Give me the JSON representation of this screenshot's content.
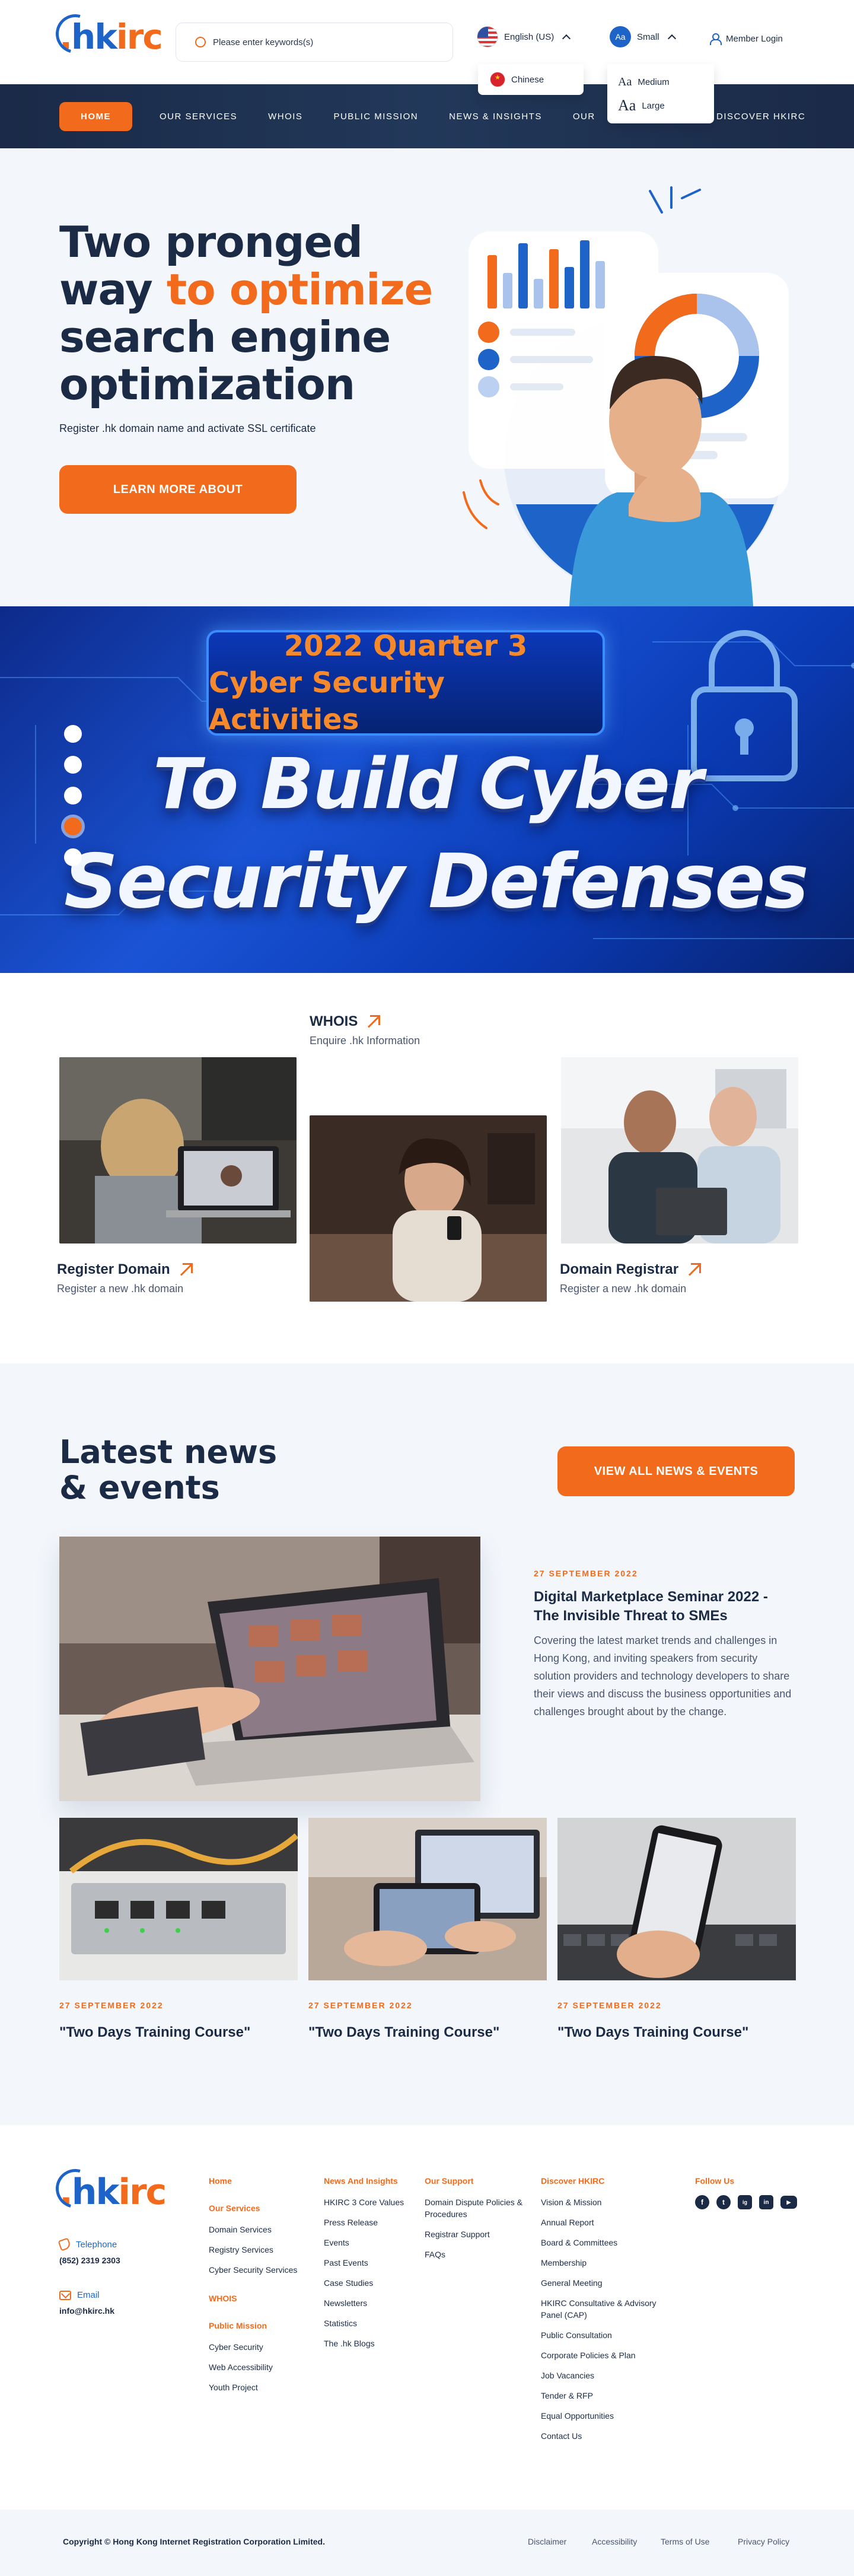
{
  "brand": {
    "dot": ".",
    "hk": "hk",
    "irc": "irc"
  },
  "search": {
    "placeholder": "Please enter keywords(s)"
  },
  "language": {
    "current": "English (US)",
    "option": "Chinese"
  },
  "font_size": {
    "badge": "Aa",
    "current": "Small",
    "options": [
      {
        "glyph": "Aa",
        "label": "Medium"
      },
      {
        "glyph": "Aa",
        "label": "Large"
      }
    ]
  },
  "member_login": "Member Login",
  "nav": {
    "items": [
      "Home",
      "Our Services",
      "WHOIS",
      "Public Mission",
      "News & Insights",
      "Our",
      "Discover HKIRC"
    ]
  },
  "hero": {
    "title_line1": "Two pronged",
    "title_line2a": "way ",
    "title_line2b": "to optimize",
    "title_line3": "search engine",
    "title_line4": "optimization",
    "subtitle": "Register .hk domain name and activate SSL certificate",
    "cta": "LEARN MORE ABOUT"
  },
  "banner": {
    "quarter_line1": "2022 Quarter 3",
    "quarter_line2": "Cyber Security Activities",
    "headline1": "To Build Cyber",
    "headline2": "Security Defenses",
    "slides": 5,
    "active_slide": 4
  },
  "services": [
    {
      "title": "Register Domain",
      "desc": "Register a new .hk domain"
    },
    {
      "title": "WHOIS",
      "desc": "Enquire .hk Information"
    },
    {
      "title": "Domain Registrar",
      "desc": "Register a new .hk domain"
    }
  ],
  "news": {
    "heading_line1": "Latest news",
    "heading_line2": "& events",
    "view_all": "VIEW ALL NEWS & EVENTS",
    "featured": {
      "date": "27 SEPTEMBER 2022",
      "title": "Digital Marketplace Seminar 2022 - The Invisible Threat to SMEs",
      "body": "Covering the latest market trends and challenges in Hong Kong, and inviting speakers from security solution providers and technology developers to share their views and discuss the business opportunities and challenges brought about by the change."
    },
    "cards": [
      {
        "date": "27 SEPTEMBER 2022",
        "title": "\"Two Days Training Course\""
      },
      {
        "date": "27 SEPTEMBER 2022",
        "title": "\"Two Days Training Course\""
      },
      {
        "date": "27 SEPTEMBER 2022",
        "title": "\"Two Days Training Course\""
      }
    ]
  },
  "footer": {
    "telephone_label": "Telephone",
    "telephone": "(852) 2319 2303",
    "email_label": "Email",
    "email": "info@hkirc.hk",
    "col1": {
      "home": "Home",
      "our_services": "Our Services",
      "services_links": [
        "Domain Services",
        "Registry Services",
        "Cyber Security Services"
      ],
      "whois": "WHOIS",
      "public_mission": "Public Mission",
      "mission_links": [
        "Cyber Security",
        "Web Accessibility",
        "Youth Project"
      ]
    },
    "col2": {
      "head": "News And Insights",
      "links": [
        "HKIRC 3 Core Values",
        "Press Release",
        "Events",
        "Past Events",
        "Case Studies",
        "Newsletters",
        "Statistics",
        "The .hk Blogs"
      ]
    },
    "col3": {
      "head": "Our Support",
      "links": [
        "Domain Dispute Policies & Procedures",
        "Registrar Support",
        "FAQs"
      ]
    },
    "col4": {
      "head": "Discover HKIRC",
      "links": [
        "Vision & Mission",
        "Annual Report",
        "Board & Committees",
        "Membership",
        "General Meeting",
        "HKIRC Consultative & Advisory Panel (CAP)",
        "Public Consultation",
        "Corporate Policies & Plan",
        "Job Vacancies",
        "Tender & RFP",
        "Equal Opportunities",
        "Contact Us"
      ]
    },
    "follow_us": "Follow Us",
    "social": [
      "f",
      "t",
      "ig",
      "in",
      "▶"
    ],
    "copyright": "Copyright © Hong Kong Internet Registration Corporation Limited.",
    "legal": [
      "Disclaimer",
      "Accessibility",
      "Terms of Use",
      "Privacy Policy"
    ]
  },
  "colors": {
    "accent": "#f26b1d",
    "brand_blue": "#1e64c8",
    "navy": "#1c2b45",
    "section_bg": "#f3f6fb"
  }
}
